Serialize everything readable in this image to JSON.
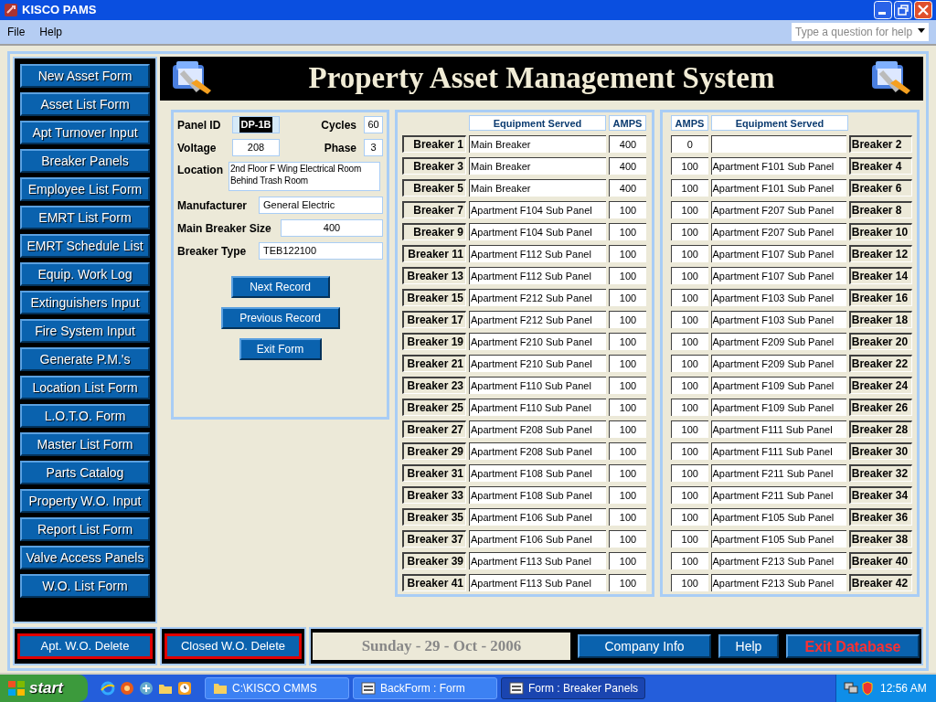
{
  "window": {
    "title": "KISCO PAMS"
  },
  "menu": [
    "File",
    "Help"
  ],
  "help_box": {
    "placeholder": "Type a question for help"
  },
  "header": {
    "title": "Property Asset Management System"
  },
  "sidebar": [
    "New Asset Form",
    "Asset List Form",
    "Apt Turnover Input",
    "Breaker Panels",
    "Employee List Form",
    "EMRT List Form",
    "EMRT Schedule List",
    "Equip. Work Log",
    "Extinguishers Input",
    "Fire System Input",
    "Generate P.M.'s",
    "Location List Form",
    "L.O.T.O. Form",
    "Master List Form",
    "Parts Catalog",
    "Property W.O. Input",
    "Report List Form",
    "Valve Access Panels",
    "W.O. List Form"
  ],
  "panel": {
    "panel_id": {
      "label": "Panel ID",
      "value": "DP-1B",
      "highlighted": true
    },
    "cycles": {
      "label": "Cycles",
      "value": "60"
    },
    "voltage": {
      "label": "Voltage",
      "value": "208"
    },
    "phase": {
      "label": "Phase",
      "value": "3"
    },
    "location": {
      "label": "Location",
      "value": "2nd Floor F Wing Electrical Room Behind Trash Room"
    },
    "manufacturer": {
      "label": "Manufacturer",
      "value": "General Electric"
    },
    "main_breaker_size": {
      "label": "Main Breaker Size",
      "value": "400"
    },
    "breaker_type": {
      "label": "Breaker Type",
      "value": "TEB122100"
    },
    "buttons": [
      "Next Record",
      "Previous Record",
      "Exit Form"
    ]
  },
  "odd_breakers": {
    "columns": [
      "Equipment Served",
      "AMPS"
    ],
    "rows": [
      {
        "label": "Breaker 1",
        "equipment": "Main Breaker",
        "amps": "400"
      },
      {
        "label": "Breaker 3",
        "equipment": "Main Breaker",
        "amps": "400"
      },
      {
        "label": "Breaker 5",
        "equipment": "Main Breaker",
        "amps": "400"
      },
      {
        "label": "Breaker 7",
        "equipment": "Apartment F104 Sub Panel",
        "amps": "100"
      },
      {
        "label": "Breaker 9",
        "equipment": "Apartment F104 Sub Panel",
        "amps": "100"
      },
      {
        "label": "Breaker 11",
        "equipment": "Apartment F112 Sub Panel",
        "amps": "100"
      },
      {
        "label": "Breaker 13",
        "equipment": "Apartment F112 Sub Panel",
        "amps": "100"
      },
      {
        "label": "Breaker 15",
        "equipment": "Apartment F212 Sub Panel",
        "amps": "100"
      },
      {
        "label": "Breaker 17",
        "equipment": "Apartment F212 Sub Panel",
        "amps": "100"
      },
      {
        "label": "Breaker 19",
        "equipment": "Apartment F210 Sub Panel",
        "amps": "100"
      },
      {
        "label": "Breaker 21",
        "equipment": "Apartment F210 Sub Panel",
        "amps": "100"
      },
      {
        "label": "Breaker 23",
        "equipment": "Apartment F110 Sub Panel",
        "amps": "100"
      },
      {
        "label": "Breaker 25",
        "equipment": "Apartment F110 Sub Panel",
        "amps": "100"
      },
      {
        "label": "Breaker 27",
        "equipment": "Apartment F208 Sub Panel",
        "amps": "100"
      },
      {
        "label": "Breaker 29",
        "equipment": "Apartment F208 Sub Panel",
        "amps": "100"
      },
      {
        "label": "Breaker 31",
        "equipment": "Apartment F108 Sub Panel",
        "amps": "100"
      },
      {
        "label": "Breaker 33",
        "equipment": "Apartment F108 Sub Panel",
        "amps": "100"
      },
      {
        "label": "Breaker 35",
        "equipment": "Apartment F106 Sub Panel",
        "amps": "100"
      },
      {
        "label": "Breaker 37",
        "equipment": "Apartment F106 Sub Panel",
        "amps": "100"
      },
      {
        "label": "Breaker 39",
        "equipment": "Apartment F113 Sub Panel",
        "amps": "100"
      },
      {
        "label": "Breaker 41",
        "equipment": "Apartment F113 Sub Panel",
        "amps": "100"
      }
    ]
  },
  "even_breakers": {
    "columns": [
      "AMPS",
      "Equipment Served"
    ],
    "rows": [
      {
        "label": "Breaker 2",
        "amps": "0"
      },
      {
        "label": "Breaker 4",
        "equipment": "Apartment F101 Sub Panel",
        "amps": "100"
      },
      {
        "label": "Breaker 6",
        "equipment": "Apartment F101 Sub Panel",
        "amps": "100"
      },
      {
        "label": "Breaker 8",
        "equipment": "Apartment F207 Sub Panel",
        "amps": "100"
      },
      {
        "label": "Breaker 10",
        "equipment": "Apartment F207 Sub Panel",
        "amps": "100"
      },
      {
        "label": "Breaker 12",
        "equipment": "Apartment F107 Sub Panel",
        "amps": "100"
      },
      {
        "label": "Breaker 14",
        "equipment": "Apartment F107 Sub Panel",
        "amps": "100"
      },
      {
        "label": "Breaker 16",
        "equipment": "Apartment F103 Sub Panel",
        "amps": "100"
      },
      {
        "label": "Breaker 18",
        "equipment": "Apartment F103 Sub Panel",
        "amps": "100"
      },
      {
        "label": "Breaker 20",
        "equipment": "Apartment F209 Sub Panel",
        "amps": "100"
      },
      {
        "label": "Breaker 22",
        "equipment": "Apartment F209 Sub Panel",
        "amps": "100"
      },
      {
        "label": "Breaker 24",
        "equipment": "Apartment F109 Sub Panel",
        "amps": "100"
      },
      {
        "label": "Breaker 26",
        "equipment": "Apartment F109 Sub Panel",
        "amps": "100"
      },
      {
        "label": "Breaker 28",
        "equipment": "Apartment F111 Sub Panel",
        "amps": "100"
      },
      {
        "label": "Breaker 30",
        "equipment": "Apartment F111 Sub Panel",
        "amps": "100"
      },
      {
        "label": "Breaker 32",
        "equipment": "Apartment F211 Sub Panel",
        "amps": "100"
      },
      {
        "label": "Breaker 34",
        "equipment": "Apartment F211 Sub Panel",
        "amps": "100"
      },
      {
        "label": "Breaker 36",
        "equipment": "Apartment F105 Sub Panel",
        "amps": "100"
      },
      {
        "label": "Breaker 38",
        "equipment": "Apartment F105 Sub Panel",
        "amps": "100"
      },
      {
        "label": "Breaker 40",
        "equipment": "Apartment F213 Sub Panel",
        "amps": "100"
      },
      {
        "label": "Breaker 42",
        "equipment": "Apartment F213 Sub Panel",
        "amps": "100"
      }
    ]
  },
  "bottom_left": [
    {
      "label": "Apt. W.O. Delete",
      "kind": "outlined"
    },
    {
      "label": "Closed W.O. Delete",
      "kind": "outlined"
    }
  ],
  "date": "Sunday - 29 - Oct - 2006",
  "bottom_right": [
    {
      "label": "Company Info",
      "kind": "plain"
    },
    {
      "label": "Help",
      "kind": "plain"
    },
    {
      "label": "Exit Database",
      "kind": "alert"
    }
  ],
  "taskbar": {
    "start": "start",
    "tasks": [
      {
        "label": "C:\\KISCO CMMS",
        "kind": "folder",
        "selected": false
      },
      {
        "label": "BackForm : Form",
        "kind": "form",
        "selected": false
      },
      {
        "label": "Form : Breaker Panels",
        "kind": "form",
        "selected": true
      }
    ],
    "clock": "12:56 AM"
  }
}
